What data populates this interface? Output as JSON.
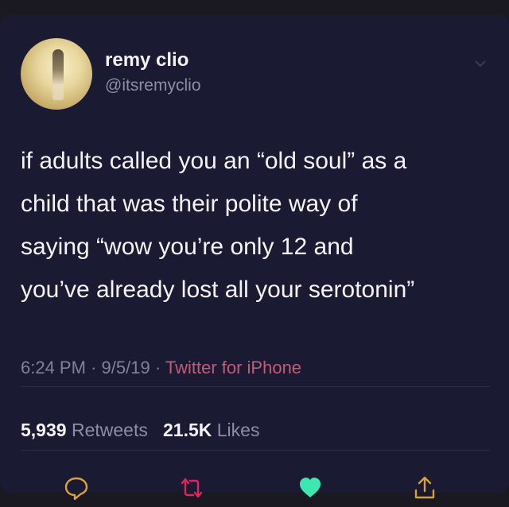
{
  "user": {
    "display_name": "remy clio",
    "handle": "@itsremyclio"
  },
  "tweet": {
    "lines": [
      "if adults called you an “old soul” as a",
      "child that was their polite way of",
      "saying “wow you’re only 12 and",
      "you’ve already lost all your serotonin”"
    ],
    "time": "6:24 PM",
    "date": "9/5/19",
    "separator": "·",
    "source": "Twitter for iPhone"
  },
  "stats": {
    "retweets_count": "5,939",
    "retweets_label": "Retweets",
    "likes_count": "21.5K",
    "likes_label": "Likes"
  },
  "actions": {
    "reply_icon": "speech-bubble-icon",
    "retweet_icon": "retweet-arrows-icon",
    "like_icon": "heart-icon",
    "share_icon": "share-arrow-icon"
  },
  "colors": {
    "background": "#1b1a33",
    "text": "#f4f4f8",
    "muted": "#8b8fa3",
    "source_link": "#c45a73",
    "retweet_icon": "#e0245e",
    "heart_liked": "#3ee6b0",
    "share_icon": "#d4a03b"
  }
}
